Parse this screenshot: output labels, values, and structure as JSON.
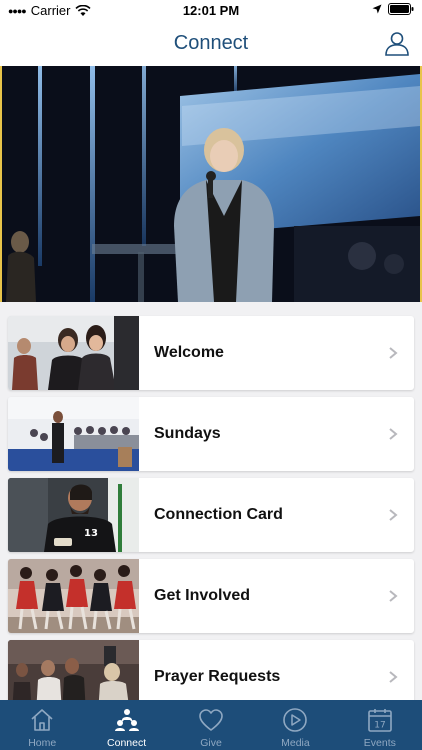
{
  "status": {
    "carrier": "Carrier",
    "time": "12:01 PM"
  },
  "header": {
    "title": "Connect"
  },
  "items": [
    {
      "label": "Welcome"
    },
    {
      "label": "Sundays"
    },
    {
      "label": "Connection Card"
    },
    {
      "label": "Get Involved"
    },
    {
      "label": "Prayer Requests"
    }
  ],
  "tabs": [
    {
      "label": "Home",
      "icon": "home-icon"
    },
    {
      "label": "Connect",
      "icon": "connect-icon"
    },
    {
      "label": "Give",
      "icon": "heart-icon"
    },
    {
      "label": "Media",
      "icon": "play-icon"
    },
    {
      "label": "Events",
      "icon": "calendar-icon",
      "calendar_day": "17"
    }
  ],
  "active_tab": "Connect",
  "colors": {
    "brand": "#1d4d79",
    "title": "#1f4f7a",
    "hero_frame": "#e8c44a"
  }
}
